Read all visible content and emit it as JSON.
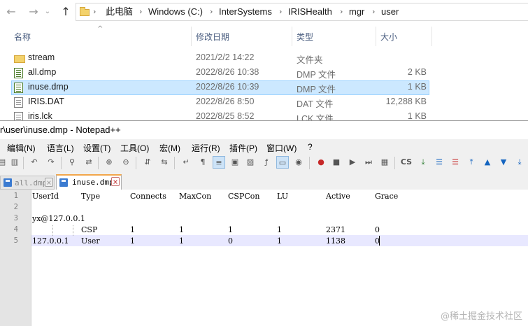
{
  "explorer": {
    "breadcrumbs": [
      "此电脑",
      "Windows (C:)",
      "InterSystems",
      "IRISHealth",
      "mgr",
      "user"
    ],
    "columns": {
      "name": "名称",
      "modified": "修改日期",
      "type": "类型",
      "size": "大小"
    },
    "files": [
      {
        "name": "stream",
        "modified": "2021/2/2 14:22",
        "type": "文件夹",
        "size": "",
        "icon": "folder-icon"
      },
      {
        "name": "all.dmp",
        "modified": "2022/8/26 10:38",
        "type": "DMP 文件",
        "size": "2 KB",
        "icon": "dmp-file-icon"
      },
      {
        "name": "inuse.dmp",
        "modified": "2022/8/26 10:39",
        "type": "DMP 文件",
        "size": "1 KB",
        "icon": "dmp-file-icon",
        "selected": true
      },
      {
        "name": "IRIS.DAT",
        "modified": "2022/8/26 8:50",
        "type": "DAT 文件",
        "size": "12,288 KB",
        "icon": "file-icon"
      },
      {
        "name": "iris.lck",
        "modified": "2022/8/25 8:52",
        "type": "LCK 文件",
        "size": "1 KB",
        "icon": "file-icon"
      }
    ],
    "selection_color": "#cce8ff"
  },
  "notepad": {
    "title": "r\\user\\inuse.dmp - Notepad++",
    "menu": [
      "编辑(N)",
      "语言(L)",
      "设置(T)",
      "工具(O)",
      "宏(M)",
      "运行(R)",
      "插件(P)",
      "窗口(W)",
      "?"
    ],
    "tabs": [
      {
        "label": "all.dmp",
        "active": false
      },
      {
        "label": "inuse.dmp",
        "active": true
      }
    ],
    "line_numbers": [
      "1",
      "2",
      "3",
      "4",
      "5"
    ],
    "lines": [
      [
        "UserId",
        "Type",
        "Connects",
        "MaxCon",
        "CSPCon",
        "LU",
        "Active",
        "Grace"
      ],
      [],
      [
        "yx@127.0.0.1"
      ],
      [
        "",
        "CSP",
        "1",
        "1",
        "1",
        "1",
        "2371",
        "0"
      ],
      [
        "127.0.0.1",
        "User",
        "1",
        "1",
        "0",
        "1",
        "1138",
        "0"
      ]
    ],
    "current_line_color": "#e8e8ff",
    "tab_accent": "#f2a64b"
  },
  "watermark": "@稀土掘金技术社区"
}
